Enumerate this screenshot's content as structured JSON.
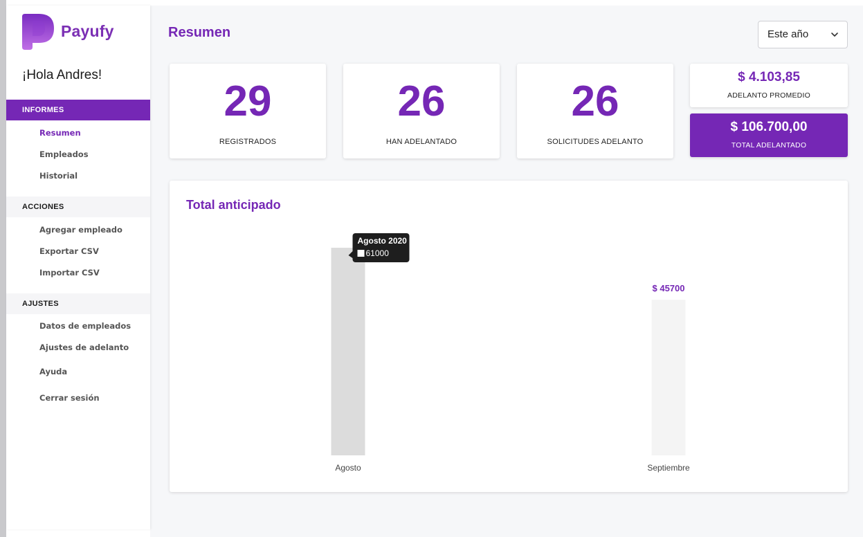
{
  "app": {
    "name": "Payufy",
    "brand_color": "#7527b5"
  },
  "sidebar": {
    "greeting": "¡Hola Andres!",
    "sections": [
      {
        "header": "INFORMES",
        "items": [
          "Resumen",
          "Empleados",
          "Historial"
        ]
      },
      {
        "header": "ACCIONES",
        "items": [
          "Agregar empleado",
          "Exportar CSV",
          "Importar CSV"
        ]
      },
      {
        "header": "AJUSTES",
        "items": [
          "Datos de empleados",
          "Ajustes de adelanto",
          "Ayuda",
          "Cerrar sesión"
        ]
      }
    ],
    "active_item": "Resumen"
  },
  "header": {
    "title": "Resumen",
    "period_select": {
      "value": "Este año"
    }
  },
  "stats": [
    {
      "value": "29",
      "label": "REGISTRADOS"
    },
    {
      "value": "26",
      "label": "HAN ADELANTADO"
    },
    {
      "value": "26",
      "label": "SOLICITUDES ADELANTO"
    }
  ],
  "summary": {
    "average": {
      "value": "$ 4.103,85",
      "label": "ADELANTO PROMEDIO"
    },
    "total": {
      "value": "$ 106.700,00",
      "label": "TOTAL ADELANTADO"
    }
  },
  "chart": {
    "title": "Total anticipado",
    "tooltip": {
      "title": "Agosto 2020",
      "value": "61000"
    }
  },
  "chart_data": {
    "type": "bar",
    "title": "Total anticipado",
    "categories": [
      "Agosto",
      "Septiembre"
    ],
    "values": [
      61000,
      45700
    ],
    "value_labels": [
      "",
      "$ 45700"
    ],
    "colors": [
      "#dcdcdc",
      "#f4f4f4"
    ],
    "hover_index": 0,
    "ylim": [
      0,
      61000
    ],
    "grid": false,
    "xlabel": "",
    "ylabel": ""
  }
}
